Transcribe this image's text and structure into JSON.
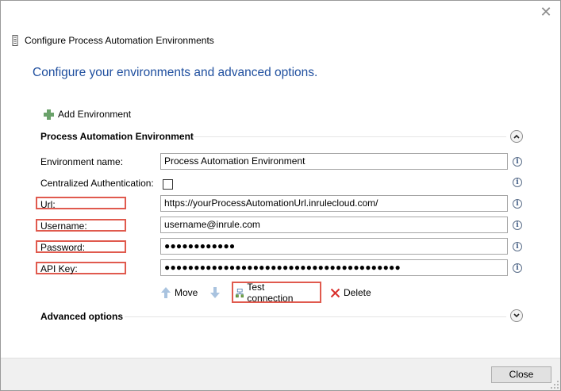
{
  "window": {
    "title": "Configure Process Automation Environments",
    "close_glyph": "✕"
  },
  "heading": "Configure your environments and advanced options.",
  "toolbar": {
    "add_environment_label": "Add Environment"
  },
  "environment_section": {
    "title": "Process Automation Environment",
    "toggle_icon": "chevron-up-icon"
  },
  "form": {
    "environment_name": {
      "label": "Environment name:",
      "value": "Process Automation Environment"
    },
    "centralized_auth": {
      "label": "Centralized Authentication:",
      "checked": false
    },
    "url": {
      "label": "Url:",
      "value": "https://yourProcessAutomationUrl.inrulecloud.com/"
    },
    "username": {
      "label": "Username:",
      "value": "username@inrule.com"
    },
    "password": {
      "label": "Password:",
      "value": "●●●●●●●●●●●●"
    },
    "api_key": {
      "label": "API Key:",
      "value": "●●●●●●●●●●●●●●●●●●●●●●●●●●●●●●●●●●●●●●●●"
    },
    "info_glyph": "i"
  },
  "actions": {
    "move_label": "Move",
    "test_connection_label": "Test connection",
    "delete_label": "Delete"
  },
  "advanced_section": {
    "title": "Advanced options",
    "toggle_icon": "chevron-down-icon"
  },
  "footer": {
    "close_label": "Close"
  },
  "colors": {
    "heading": "#1e4e9e",
    "highlight": "#e05a4e",
    "add_icon": "#6ba26b",
    "delete_icon": "#d9302c",
    "move_icon": "#a9c3df"
  }
}
